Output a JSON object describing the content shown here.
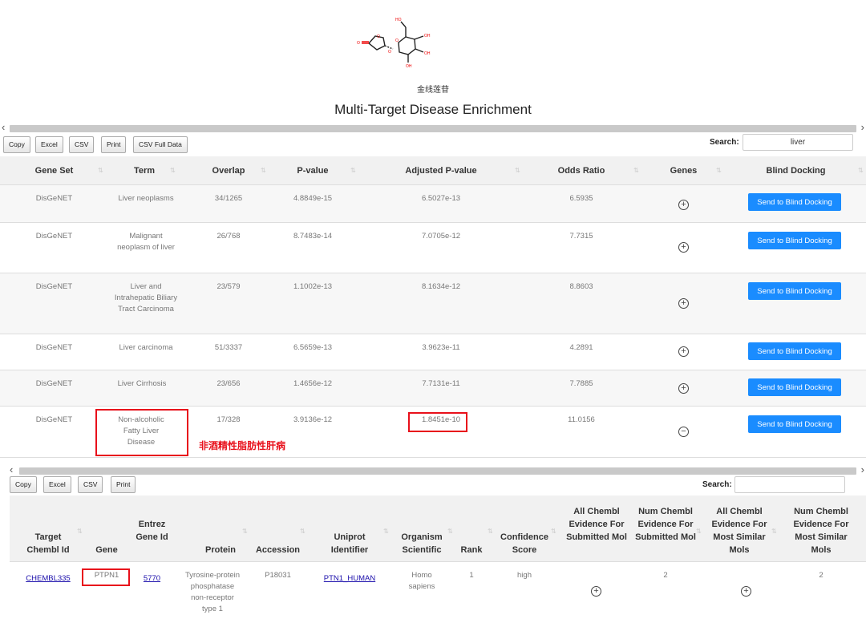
{
  "compound": {
    "name": "金线莲苷"
  },
  "page_title": "Multi-Target Disease Enrichment",
  "table1": {
    "buttons": [
      "Copy",
      "Excel",
      "CSV",
      "Print",
      "CSV Full Data"
    ],
    "search_label": "Search:",
    "search_value": "liver",
    "columns": [
      "Gene Set",
      "Term",
      "Overlap",
      "P-value",
      "Adjusted P-value",
      "Odds Ratio",
      "Genes",
      "Blind Docking"
    ],
    "rows": [
      {
        "gene_set": "DisGeNET",
        "term": "Liver neoplasms",
        "overlap": "34/1265",
        "p_value": "4.8849e-15",
        "adj_p_value": "6.5027e-13",
        "odds_ratio": "6.5935",
        "genes_icon": "plus-circle",
        "action": "Send to Blind Docking"
      },
      {
        "gene_set": "DisGeNET",
        "term": "Malignant neoplasm of liver",
        "overlap": "26/768",
        "p_value": "8.7483e-14",
        "adj_p_value": "7.0705e-12",
        "odds_ratio": "7.7315",
        "genes_icon": "plus-circle",
        "action": "Send to Blind Docking"
      },
      {
        "gene_set": "DisGeNET",
        "term": "Liver and Intrahepatic Biliary Tract Carcinoma",
        "overlap": "23/579",
        "p_value": "1.1002e-13",
        "adj_p_value": "8.1634e-12",
        "odds_ratio": "8.8603",
        "genes_icon": "plus-circle",
        "action": "Send to Blind Docking"
      },
      {
        "gene_set": "DisGeNET",
        "term": "Liver carcinoma",
        "overlap": "51/3337",
        "p_value": "6.5659e-13",
        "adj_p_value": "3.9623e-11",
        "odds_ratio": "4.2891",
        "genes_icon": "plus-circle",
        "action": "Send to Blind Docking"
      },
      {
        "gene_set": "DisGeNET",
        "term": "Liver Cirrhosis",
        "overlap": "23/656",
        "p_value": "1.4656e-12",
        "adj_p_value": "7.7131e-11",
        "odds_ratio": "7.7885",
        "genes_icon": "plus-circle",
        "action": "Send to Blind Docking"
      },
      {
        "gene_set": "DisGeNET",
        "term": "Non-alcoholic Fatty Liver Disease",
        "overlap": "17/328",
        "p_value": "3.9136e-12",
        "adj_p_value": "1.8451e-10",
        "odds_ratio": "11.0156",
        "genes_icon": "minus-circle",
        "action": "Send to Blind Docking"
      }
    ],
    "annotation": "非酒精性脂肪性肝病",
    "highlight_color": "#e8101b",
    "button_color": "#1a8cff"
  },
  "table2": {
    "buttons": [
      "Copy",
      "Excel",
      "CSV",
      "Print"
    ],
    "search_label": "Search:",
    "search_value": "",
    "columns": [
      "Target Chembl Id",
      "Gene",
      "Entrez Gene Id",
      "Protein",
      "Accession",
      "Uniprot Identifier",
      "Organism Scientific",
      "Rank",
      "Confidence Score",
      "All Chembl Evidence For Submitted Mol",
      "Num Chembl Evidence For Submitted Mol",
      "All Chembl Evidence For Most Similar Mols",
      "Num Chembl Evidence For Most Similar Mols"
    ],
    "rows": [
      {
        "target_chembl_id": "CHEMBL335",
        "gene": "PTPN1",
        "entrez_gene_id": "5770",
        "protein": "Tyrosine-protein phosphatase non-receptor type 1",
        "accession": "P18031",
        "uniprot_identifier": "PTN1_HUMAN",
        "organism": "Homo sapiens",
        "rank": "1",
        "confidence": "high",
        "all_submitted_icon": "plus-circle",
        "num_submitted": "2",
        "all_similar_icon": "plus-circle",
        "num_similar": "2"
      }
    ]
  }
}
